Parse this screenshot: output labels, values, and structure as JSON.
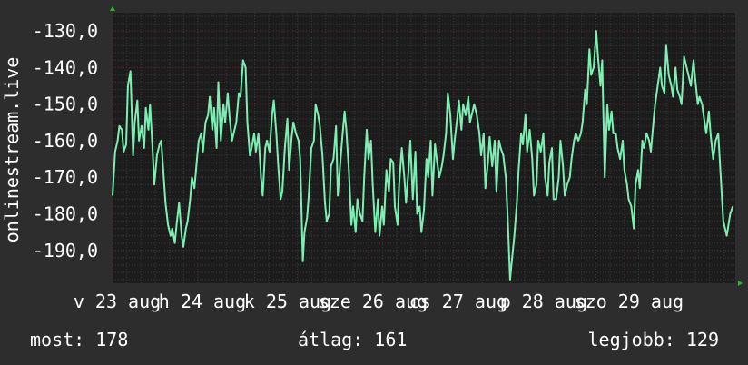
{
  "colors": {
    "background": "#2d2d2d",
    "plot_background": "#1c1c1c",
    "grid_major": "#5a2a2a",
    "grid_minor": "#3a3a3a",
    "line": "#7cf0b4",
    "axis_arrow": "#1fbf1f",
    "text": "#ffffff"
  },
  "stats": {
    "current": "most: 178",
    "average": "átlag: 161",
    "best": "legjobb: 129"
  },
  "chart_data": {
    "type": "line",
    "ylabel": "onlinestream.live",
    "xlabel": "",
    "ylim": [
      -199,
      -125
    ],
    "y_ticks": [
      -130,
      -140,
      -150,
      -160,
      -170,
      -180,
      -190
    ],
    "y_tick_labels": [
      "-130,0",
      "-140,0",
      "-150,0",
      "-160,0",
      "-170,0",
      "-180,0",
      "-190,0"
    ],
    "x_range_days": [
      0,
      7.3
    ],
    "x_ticks": [
      {
        "day": 0.0,
        "label": "v 23 aug"
      },
      {
        "day": 1.0,
        "label": "h 24 aug"
      },
      {
        "day": 2.0,
        "label": "k 25 aug"
      },
      {
        "day": 3.0,
        "label": "sze 26 aug"
      },
      {
        "day": 4.0,
        "label": "cs 27 aug"
      },
      {
        "day": 5.0,
        "label": "p 28 aug"
      },
      {
        "day": 6.0,
        "label": "szo 29 aug"
      }
    ],
    "series": [
      {
        "x": [
          0.0,
          0.03,
          0.06,
          0.08,
          0.11,
          0.13,
          0.16,
          0.18,
          0.21,
          0.24,
          0.26,
          0.29,
          0.31,
          0.34,
          0.37,
          0.39,
          0.42,
          0.44,
          0.47,
          0.49,
          0.52,
          0.55,
          0.57,
          0.6,
          0.62,
          0.65,
          0.68,
          0.7,
          0.73,
          0.75,
          0.78,
          0.81,
          0.83,
          0.86,
          0.88,
          0.91,
          0.93,
          0.96,
          0.99,
          1.01,
          1.04,
          1.06,
          1.09,
          1.12,
          1.14,
          1.17,
          1.19,
          1.22,
          1.24,
          1.27,
          1.3,
          1.32,
          1.35,
          1.37,
          1.4,
          1.43,
          1.45,
          1.48,
          1.5,
          1.53,
          1.56,
          1.58,
          1.61,
          1.63,
          1.66,
          1.68,
          1.71,
          1.74,
          1.76,
          1.79,
          1.81,
          1.84,
          1.87,
          1.89,
          1.92,
          1.94,
          1.97,
          1.99,
          2.02,
          2.05,
          2.07,
          2.1,
          2.12,
          2.15,
          2.18,
          2.2,
          2.23,
          2.25,
          2.28,
          2.3,
          2.33,
          2.36,
          2.38,
          2.41,
          2.43,
          2.46,
          2.49,
          2.51,
          2.54,
          2.56,
          2.59,
          2.62,
          2.64,
          2.67,
          2.69,
          2.72,
          2.74,
          2.77,
          2.8,
          2.82,
          2.85,
          2.87,
          2.9,
          2.93,
          2.95,
          2.98,
          3.0,
          3.03,
          3.05,
          3.08,
          3.11,
          3.13,
          3.16,
          3.18,
          3.21,
          3.24,
          3.26,
          3.29,
          3.31,
          3.34,
          3.36,
          3.39,
          3.42,
          3.44,
          3.47,
          3.49,
          3.52,
          3.55,
          3.57,
          3.6,
          3.62,
          3.65,
          3.68,
          3.7,
          3.73,
          3.75,
          3.78,
          3.8,
          3.83,
          3.86,
          3.88,
          3.91,
          3.93,
          3.96,
          3.99,
          4.01,
          4.04,
          4.06,
          4.09,
          4.11,
          4.14,
          4.17,
          4.19,
          4.22,
          4.24,
          4.27,
          4.3,
          4.32,
          4.35,
          4.37,
          4.4,
          4.42,
          4.45,
          4.48,
          4.5,
          4.53,
          4.55,
          4.58,
          4.61,
          4.63,
          4.66,
          4.68,
          4.71,
          4.74,
          4.76,
          4.79,
          4.81,
          4.84,
          4.86,
          4.89,
          4.92,
          4.94,
          4.97,
          4.99,
          5.02,
          5.05,
          5.07,
          5.1,
          5.12,
          5.15,
          5.17,
          5.2,
          5.23,
          5.25,
          5.28,
          5.3,
          5.33,
          5.36,
          5.38,
          5.41,
          5.43,
          5.46,
          5.49,
          5.51,
          5.54,
          5.56,
          5.59,
          5.61,
          5.64,
          5.67,
          5.69,
          5.72,
          5.74,
          5.77,
          5.8,
          5.82,
          5.85,
          5.87,
          5.9,
          5.92,
          5.95,
          5.98,
          6.0,
          6.03,
          6.05,
          6.08,
          6.11,
          6.13,
          6.16,
          6.18,
          6.21,
          6.23,
          6.26,
          6.29,
          6.31,
          6.34,
          6.36,
          6.39,
          6.42,
          6.44,
          6.47,
          6.49,
          6.52,
          6.55,
          6.57,
          6.6,
          6.62,
          6.65,
          6.67,
          6.7,
          6.73,
          6.75,
          6.78,
          6.81,
          6.83,
          6.86,
          6.88,
          6.91,
          6.94,
          6.96,
          6.99,
          7.01,
          7.04,
          7.07,
          7.1,
          7.13,
          7.16,
          7.2,
          7.24,
          7.27
        ],
        "y": [
          -175,
          -163,
          -160,
          -156,
          -157,
          -163,
          -161,
          -145,
          -141,
          -164,
          -155,
          -149,
          -160,
          -156,
          -162,
          -151,
          -157,
          -150,
          -163,
          -172,
          -164,
          -161,
          -160,
          -170,
          -177,
          -183,
          -186,
          -184,
          -188,
          -183,
          -177,
          -186,
          -189,
          -184,
          -182,
          -176,
          -170,
          -173,
          -165,
          -160,
          -158,
          -163,
          -155,
          -153,
          -148,
          -157,
          -151,
          -162,
          -144,
          -160,
          -150,
          -155,
          -147,
          -153,
          -160,
          -157,
          -155,
          -147,
          -148,
          -138,
          -140,
          -155,
          -164,
          -162,
          -158,
          -163,
          -158,
          -170,
          -175,
          -162,
          -160,
          -163,
          -153,
          -149,
          -158,
          -166,
          -176,
          -174,
          -162,
          -154,
          -168,
          -159,
          -155,
          -158,
          -160,
          -165,
          -193,
          -185,
          -181,
          -175,
          -162,
          -160,
          -150,
          -153,
          -156,
          -164,
          -177,
          -182,
          -180,
          -167,
          -165,
          -156,
          -175,
          -166,
          -160,
          -152,
          -157,
          -168,
          -183,
          -178,
          -185,
          -176,
          -180,
          -182,
          -170,
          -157,
          -165,
          -160,
          -172,
          -185,
          -176,
          -186,
          -178,
          -183,
          -168,
          -174,
          -165,
          -166,
          -178,
          -183,
          -172,
          -162,
          -170,
          -177,
          -168,
          -160,
          -176,
          -163,
          -180,
          -178,
          -185,
          -179,
          -165,
          -170,
          -160,
          -175,
          -161,
          -165,
          -170,
          -167,
          -164,
          -158,
          -147,
          -153,
          -165,
          -160,
          -154,
          -149,
          -157,
          -150,
          -153,
          -148,
          -155,
          -152,
          -150,
          -153,
          -158,
          -164,
          -158,
          -173,
          -166,
          -159,
          -167,
          -160,
          -174,
          -160,
          -162,
          -164,
          -170,
          -180,
          -198,
          -193,
          -186,
          -177,
          -168,
          -158,
          -161,
          -153,
          -163,
          -157,
          -165,
          -175,
          -172,
          -160,
          -163,
          -158,
          -170,
          -175,
          -166,
          -162,
          -176,
          -176,
          -170,
          -160,
          -167,
          -175,
          -172,
          -170,
          -165,
          -160,
          -158,
          -160,
          -158,
          -155,
          -146,
          -150,
          -135,
          -142,
          -140,
          -130,
          -137,
          -145,
          -138,
          -170,
          -150,
          -157,
          -152,
          -158,
          -158,
          -162,
          -165,
          -160,
          -168,
          -172,
          -176,
          -178,
          -184,
          -172,
          -168,
          -173,
          -160,
          -162,
          -158,
          -160,
          -163,
          -155,
          -150,
          -145,
          -140,
          -145,
          -147,
          -134,
          -142,
          -145,
          -148,
          -140,
          -146,
          -148,
          -150,
          -137,
          -140,
          -142,
          -145,
          -138,
          -143,
          -150,
          -148,
          -150,
          -155,
          -158,
          -152,
          -158,
          -165,
          -160,
          -158,
          -170,
          -182,
          -186,
          -180,
          -178
        ]
      }
    ]
  }
}
